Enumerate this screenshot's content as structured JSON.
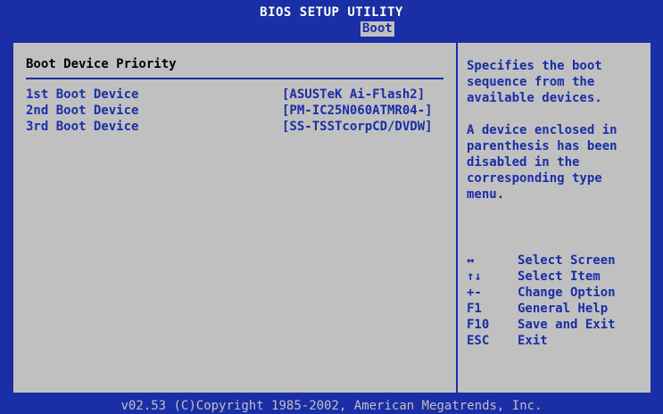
{
  "header": {
    "title": "BIOS SETUP UTILITY",
    "active_tab": "Boot"
  },
  "section": {
    "title": "Boot Device Priority"
  },
  "boot_devices": [
    {
      "label": "1st Boot Device",
      "value": "[ASUSTeK Ai-Flash2]"
    },
    {
      "label": "2nd Boot Device",
      "value": "[PM-IC25N060ATMR04-]"
    },
    {
      "label": "3rd Boot Device",
      "value": "[SS-TSSTcorpCD/DVDW]"
    }
  ],
  "help": {
    "paragraph1": "Specifies the boot sequence from the available devices.",
    "paragraph2": "A device enclosed in parenthesis has been disabled in the corresponding type menu."
  },
  "keys": [
    {
      "key": "↔",
      "desc": "Select Screen"
    },
    {
      "key": "↑↓",
      "desc": "Select Item"
    },
    {
      "key": "+-",
      "desc": "Change Option"
    },
    {
      "key": "F1",
      "desc": "General Help"
    },
    {
      "key": "F10",
      "desc": "Save and Exit"
    },
    {
      "key": "ESC",
      "desc": "Exit"
    }
  ],
  "footer": {
    "copyright": "v02.53 (C)Copyright 1985-2002, American Megatrends, Inc."
  },
  "colors": {
    "bios_blue": "#1a2ea6",
    "panel_gray": "#c0c0c0",
    "white": "#ffffff"
  }
}
